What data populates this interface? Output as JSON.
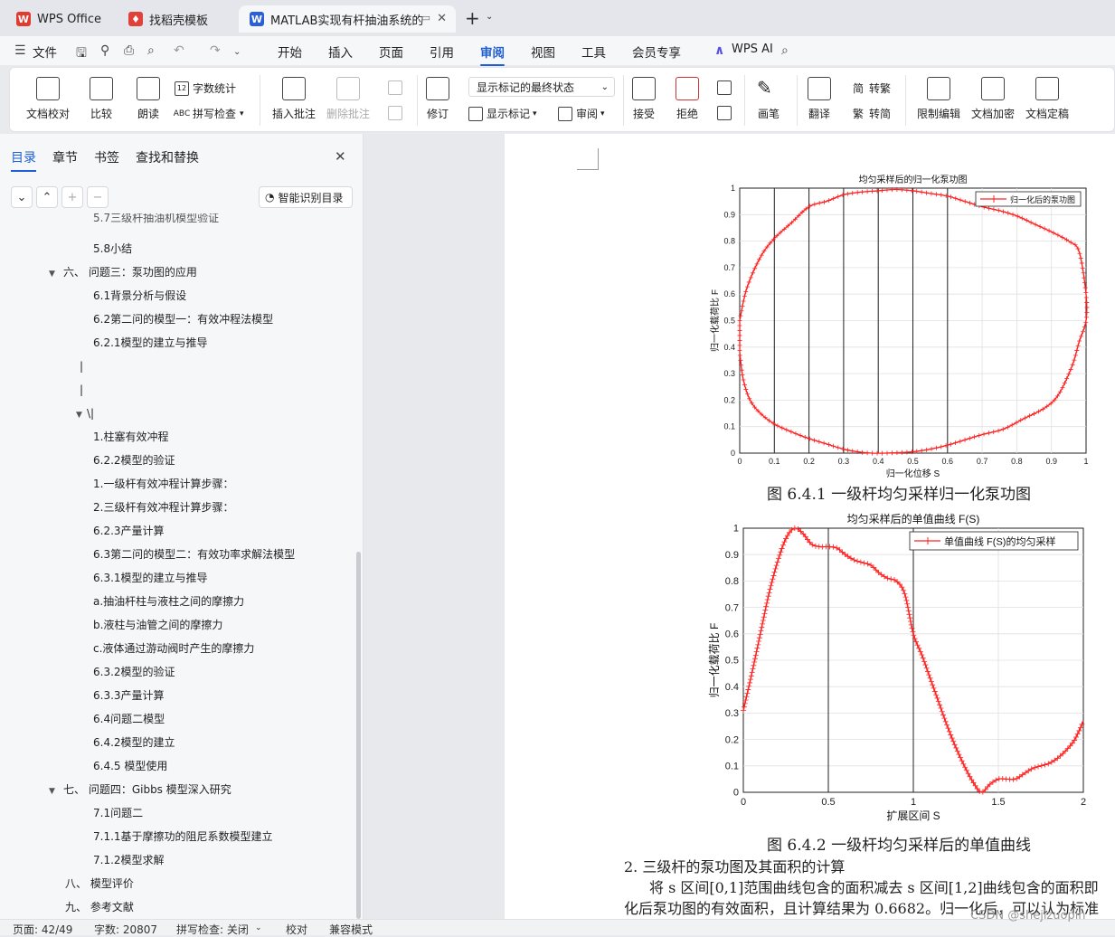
{
  "tabs": [
    {
      "label": "WPS Office",
      "icon": "wps-logo-icon",
      "color": "#e23a2d"
    },
    {
      "label": "找稻壳模板",
      "icon": "docer-icon",
      "color": "#e0413a"
    },
    {
      "label": "MATLAB实现有杆抽油系统的",
      "icon": "word-doc-icon",
      "color": "#2b5fd9"
    }
  ],
  "menu": {
    "file": "文件",
    "items": [
      "开始",
      "插入",
      "页面",
      "引用",
      "审阅",
      "视图",
      "工具",
      "会员专享"
    ],
    "active": "审阅",
    "ai": "WPS AI"
  },
  "ribbon": {
    "proof": "文档校对",
    "compare": "比较",
    "read": "朗读",
    "wordcount": "字数统计",
    "spellcheck": "拼写检查",
    "insert_comment": "插入批注",
    "delete_comment": "删除批注",
    "revise": "修订",
    "markup_state": "显示标记的最终状态",
    "show_markup": "显示标记",
    "review": "审阅",
    "accept": "接受",
    "reject": "拒绝",
    "draw": "画笔",
    "translate": "翻译",
    "to_trad": "转繁",
    "to_simp": "转简",
    "restrict": "限制编辑",
    "encrypt": "文档加密",
    "finalize": "文档定稿"
  },
  "sidebar": {
    "tabs": [
      "目录",
      "章节",
      "书签",
      "查找和替换"
    ],
    "smart_btn": "智能识别目录",
    "toc": [
      {
        "text": "5.7三级杆抽油机模型验证",
        "level": 2
      },
      {
        "text": "5.8小结",
        "level": 2
      },
      {
        "text": "六、 问题三：泵功图的应用",
        "level": 1,
        "expanded": true
      },
      {
        "text": "6.1背景分析与假设",
        "level": 2
      },
      {
        "text": "6.2第二问的模型一：有效冲程法模型",
        "level": 2
      },
      {
        "text": "6.2.1模型的建立与推导",
        "level": 2
      },
      {
        "text": "|",
        "level": 3
      },
      {
        "text": "|",
        "level": 3
      },
      {
        "text": "\\|",
        "level": 3,
        "expanded": true
      },
      {
        "text": "1.柱塞有效冲程",
        "level": 4
      },
      {
        "text": "6.2.2模型的验证",
        "level": 4
      },
      {
        "text": "1.一级杆有效冲程计算步骤：",
        "level": 4
      },
      {
        "text": "2.三级杆有效冲程计算步骤：",
        "level": 4
      },
      {
        "text": "6.2.3产量计算",
        "level": 4
      },
      {
        "text": "6.3第二问的模型二：有效功率求解法模型",
        "level": 4
      },
      {
        "text": "6.3.1模型的建立与推导",
        "level": 4
      },
      {
        "text": "a.抽油杆柱与液柱之间的摩擦力",
        "level": 4
      },
      {
        "text": "b.液柱与油管之间的摩擦力",
        "level": 4
      },
      {
        "text": "c.液体通过游动阀时产生的摩擦力",
        "level": 4
      },
      {
        "text": "6.3.2模型的验证",
        "level": 4
      },
      {
        "text": "6.3.3产量计算",
        "level": 4
      },
      {
        "text": "6.4问题二模型",
        "level": 4
      },
      {
        "text": "6.4.2模型的建立",
        "level": 4
      },
      {
        "text": "6.4.5 模型使用",
        "level": 4
      },
      {
        "text": "七、 问题四：Gibbs 模型深入研究",
        "level": 1,
        "expanded": true
      },
      {
        "text": "7.1问题二",
        "level": 2
      },
      {
        "text": "7.1.1基于摩擦功的阻尼系数模型建立",
        "level": 2
      },
      {
        "text": "7.1.2模型求解",
        "level": 2
      },
      {
        "text": "八、 模型评价",
        "level": 5
      },
      {
        "text": "九、 参考文献",
        "level": 5
      }
    ]
  },
  "chart_data": [
    {
      "type": "line",
      "title": "均匀采样后的归一化泵功图",
      "xlabel": "归一化位移 S",
      "ylabel": "归一化载荷比 F",
      "legend": "归一化后的泵功图",
      "legend_position": "top-right",
      "xlim": [
        0,
        1
      ],
      "ylim": [
        0,
        1
      ],
      "xticks": [
        "0",
        "0.1",
        "0.2",
        "0.3",
        "0.4",
        "0.5",
        "0.6",
        "0.7",
        "0.8",
        "0.9",
        "1"
      ],
      "yticks": [
        "0",
        "0.1",
        "0.2",
        "0.3",
        "0.4",
        "0.5",
        "0.6",
        "0.7",
        "0.8",
        "0.9",
        "1"
      ],
      "vlines": [
        0.1,
        0.2,
        0.3,
        0.4,
        0.5,
        0.6
      ],
      "color": "#ff2020",
      "x": [
        0.0,
        0.02,
        0.06,
        0.1,
        0.15,
        0.2,
        0.25,
        0.3,
        0.35,
        0.4,
        0.45,
        0.5,
        0.55,
        0.6,
        0.65,
        0.7,
        0.75,
        0.8,
        0.85,
        0.9,
        0.95,
        0.98,
        1.0,
        1.0,
        0.98,
        0.96,
        0.92,
        0.88,
        0.82,
        0.76,
        0.7,
        0.65,
        0.6,
        0.55,
        0.5,
        0.46,
        0.42,
        0.38,
        0.34,
        0.3,
        0.25,
        0.2,
        0.15,
        0.1,
        0.06,
        0.03,
        0.01,
        0.0
      ],
      "y": [
        0.5,
        0.62,
        0.74,
        0.81,
        0.87,
        0.93,
        0.95,
        0.975,
        0.985,
        0.99,
        0.995,
        0.99,
        0.98,
        0.97,
        0.95,
        0.93,
        0.915,
        0.895,
        0.865,
        0.835,
        0.8,
        0.76,
        0.6,
        0.5,
        0.42,
        0.33,
        0.22,
        0.17,
        0.13,
        0.09,
        0.07,
        0.05,
        0.03,
        0.015,
        0.005,
        0.002,
        0.0,
        0.0,
        0.005,
        0.015,
        0.035,
        0.055,
        0.08,
        0.11,
        0.15,
        0.2,
        0.28,
        0.38
      ]
    },
    {
      "type": "line",
      "title": "均匀采样后的单值曲线 F(S)",
      "xlabel": "扩展区间 S",
      "ylabel": "归一化载荷比 F",
      "legend": "单值曲线 F(S)的均匀采样",
      "legend_position": "top-right",
      "xlim": [
        0,
        2
      ],
      "ylim": [
        0,
        1
      ],
      "xticks": [
        "0",
        "0.5",
        "1",
        "1.5",
        "2"
      ],
      "yticks": [
        "0",
        "0.1",
        "0.2",
        "0.3",
        "0.4",
        "0.5",
        "0.6",
        "0.7",
        "0.8",
        "0.9",
        "1"
      ],
      "vlines": [
        0.5,
        1.0
      ],
      "color": "#ff2020",
      "x": [
        0.0,
        0.05,
        0.1,
        0.15,
        0.2,
        0.25,
        0.3,
        0.35,
        0.4,
        0.45,
        0.5,
        0.55,
        0.6,
        0.65,
        0.7,
        0.75,
        0.8,
        0.85,
        0.9,
        0.95,
        1.0,
        1.05,
        1.1,
        1.15,
        1.2,
        1.25,
        1.3,
        1.35,
        1.4,
        1.45,
        1.5,
        1.55,
        1.6,
        1.65,
        1.7,
        1.75,
        1.8,
        1.85,
        1.9,
        1.95,
        2.0
      ],
      "y": [
        0.31,
        0.45,
        0.6,
        0.75,
        0.87,
        0.96,
        1.0,
        0.98,
        0.94,
        0.93,
        0.93,
        0.925,
        0.9,
        0.88,
        0.87,
        0.86,
        0.83,
        0.81,
        0.8,
        0.75,
        0.6,
        0.52,
        0.43,
        0.34,
        0.25,
        0.17,
        0.1,
        0.04,
        0.0,
        0.03,
        0.05,
        0.05,
        0.05,
        0.07,
        0.09,
        0.1,
        0.11,
        0.13,
        0.16,
        0.2,
        0.27
      ]
    }
  ],
  "captions": {
    "fig1": "图  6.4.1 一级杆均匀采样归一化泵功图",
    "fig2": "图  6.4.2 一级杆均匀采样后的单值曲线"
  },
  "body_text": {
    "heading": "2. 三级杆的泵功图及其面积的计算",
    "line1": "将 s 区间[0,1]范围曲线包含的面积减去 s 区间[1,2]曲线包含的面积即",
    "line2": "化后泵功图的有效面积，且计算结果为 0.6682。归一化后，可以认为标准"
  },
  "status": {
    "page": "页面: 42/49",
    "words": "字数: 20807",
    "spell": "拼写检查: 关闭",
    "proof": "校对",
    "compat": "兼容模式",
    "watermark": "CSDN @shejizuopin"
  }
}
